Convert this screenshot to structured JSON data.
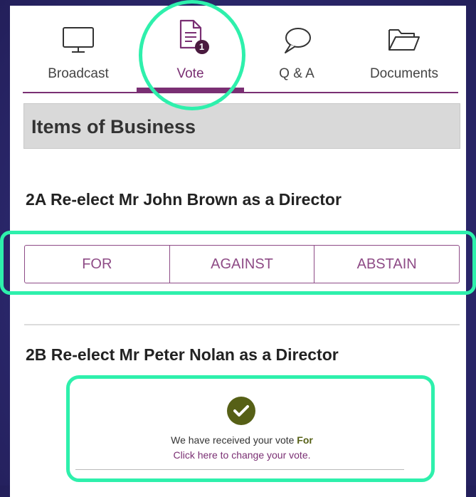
{
  "tabs": [
    {
      "label": "Broadcast",
      "icon": "monitor-icon"
    },
    {
      "label": "Vote",
      "icon": "document-icon",
      "badge": "1"
    },
    {
      "label": "Q & A",
      "icon": "speech-bubble-icon"
    },
    {
      "label": "Documents",
      "icon": "folder-icon"
    }
  ],
  "section": {
    "title": "Items of Business"
  },
  "items": [
    {
      "title": "2A Re-elect Mr John Brown as a Director",
      "options": [
        "FOR",
        "AGAINST",
        "ABSTAIN"
      ]
    },
    {
      "title": "2B Re-elect Mr Peter Nolan as a Director",
      "confirmation": {
        "message": "We have received your vote",
        "vote": "For",
        "change_link": "Click here to change your vote."
      }
    }
  ],
  "colors": {
    "accent": "#7a2f73",
    "highlight": "#2ef0ac",
    "check": "#566016",
    "background": "#2e2b73"
  }
}
